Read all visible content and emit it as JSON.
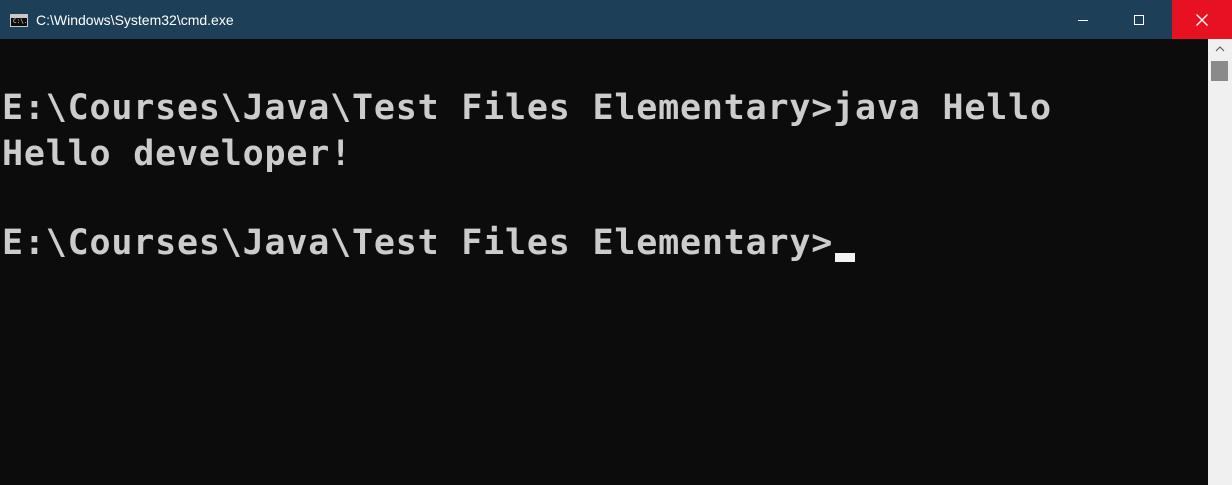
{
  "window": {
    "title": "C:\\Windows\\System32\\cmd.exe",
    "icon": "cmd-icon",
    "icon_text": "C:\\."
  },
  "controls": {
    "minimize_icon": "minimize-icon",
    "maximize_icon": "maximize-icon",
    "close_icon": "close-icon"
  },
  "console": {
    "lines": [
      "E:\\Courses\\Java\\Test Files Elementary>java Hello",
      "Hello developer!",
      "",
      "E:\\Courses\\Java\\Test Files Elementary>"
    ]
  },
  "colors": {
    "titlebar": "#1d3f58",
    "console_bg": "#0c0c0c",
    "console_text": "#cccccc",
    "close_button": "#e81123"
  }
}
